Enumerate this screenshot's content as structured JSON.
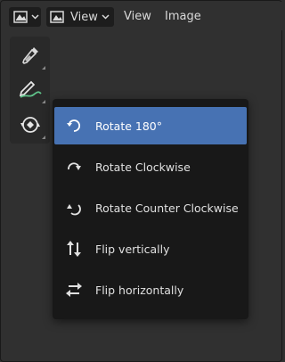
{
  "header": {
    "view_label": "View",
    "menus": [
      "View",
      "Image"
    ]
  },
  "toolbar": {
    "tools": [
      "sample-eyedropper-icon",
      "annotate-pencil-icon",
      "transform-icon"
    ]
  },
  "dropdown": {
    "items": [
      {
        "label": "Rotate 180°",
        "icon": "rotate-180-icon",
        "active": true
      },
      {
        "label": "Rotate Clockwise",
        "icon": "rotate-clockwise-icon",
        "active": false
      },
      {
        "label": "Rotate Counter Clockwise",
        "icon": "rotate-counter-clockwise-icon",
        "active": false
      },
      {
        "label": "Flip vertically",
        "icon": "flip-vertical-icon",
        "active": false
      },
      {
        "label": "Flip horizontally",
        "icon": "flip-horizontal-icon",
        "active": false
      }
    ]
  },
  "colors": {
    "accent": "#4772b3",
    "menu_bg": "#181818",
    "panel_bg": "#303030"
  }
}
